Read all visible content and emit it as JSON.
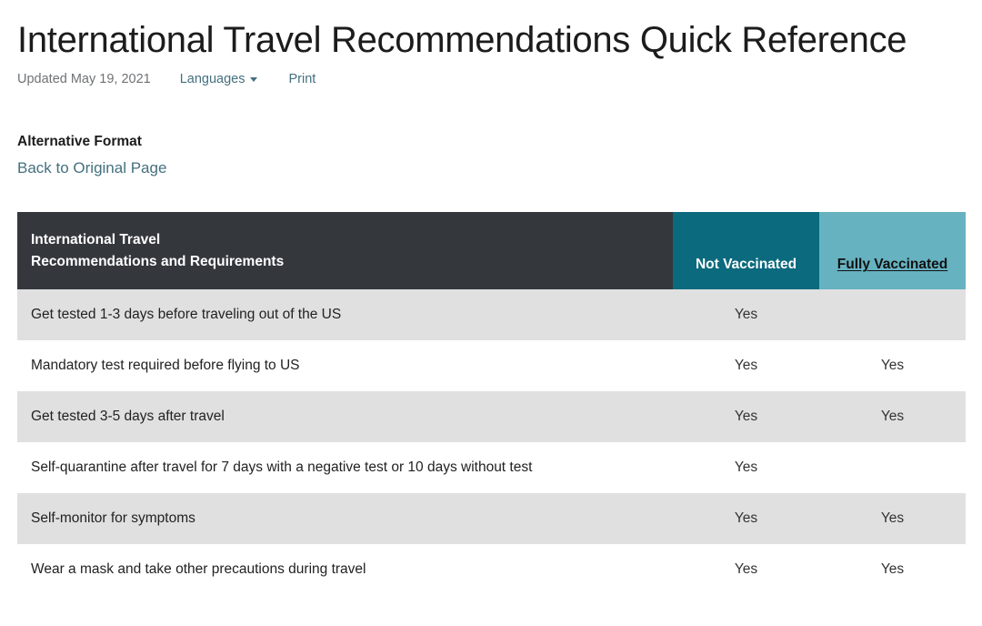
{
  "header": {
    "title": "International Travel Recommendations Quick Reference",
    "updated": "Updated May 19, 2021",
    "languages_label": "Languages",
    "print_label": "Print"
  },
  "alternative_format": {
    "heading": "Alternative Format",
    "link_label": "Back to Original Page"
  },
  "table": {
    "columns": [
      {
        "line1": "International Travel",
        "line2": "Recommendations and Requirements"
      },
      {
        "label": "Not Vaccinated"
      },
      {
        "label": "Fully Vaccinated"
      }
    ],
    "rows": [
      {
        "desc": "Get tested 1-3 days before traveling out of the US",
        "not_vaccinated": "Yes",
        "fully_vaccinated": ""
      },
      {
        "desc": "Mandatory test required before flying to US",
        "not_vaccinated": "Yes",
        "fully_vaccinated": "Yes"
      },
      {
        "desc": "Get tested 3-5 days after travel",
        "not_vaccinated": "Yes",
        "fully_vaccinated": "Yes"
      },
      {
        "desc": "Self-quarantine after travel for 7 days with a negative test or 10 days without test",
        "not_vaccinated": "Yes",
        "fully_vaccinated": ""
      },
      {
        "desc": "Self-monitor for symptoms",
        "not_vaccinated": "Yes",
        "fully_vaccinated": "Yes"
      },
      {
        "desc": "Wear a mask and take other precautions during travel",
        "not_vaccinated": "Yes",
        "fully_vaccinated": "Yes"
      }
    ]
  },
  "colors": {
    "header_dark": "#34383d",
    "header_teal": "#0b6a7d",
    "header_light_teal": "#66b2c0",
    "row_stripe": "#e0e0e0",
    "link": "#44707f"
  }
}
